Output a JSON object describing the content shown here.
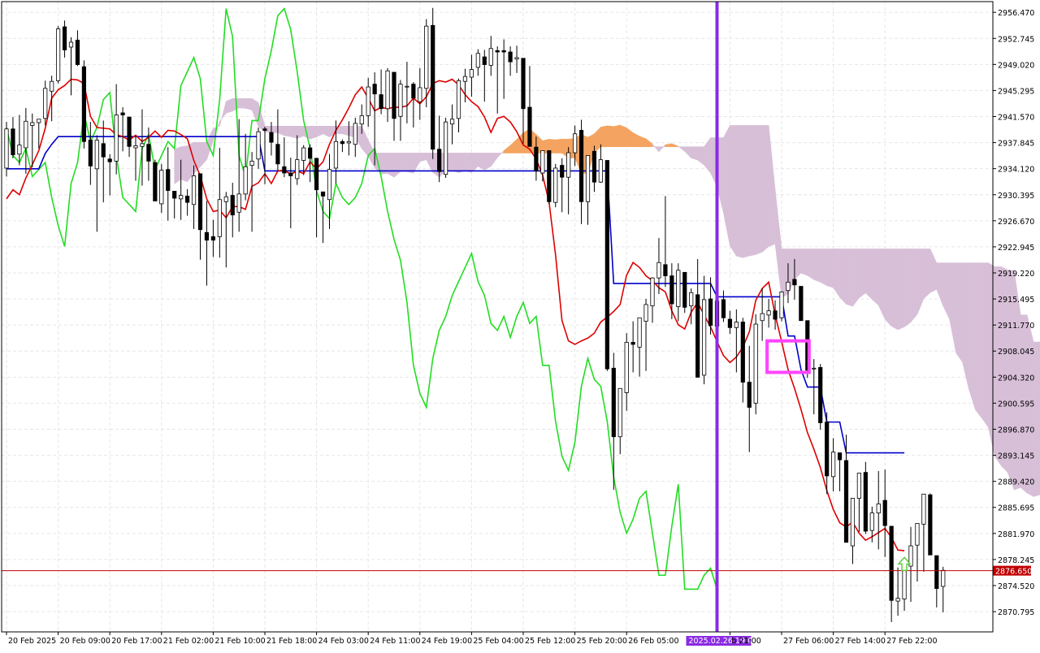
{
  "chart_data": {
    "type": "candlestick",
    "price_axis": {
      "ylim": [
        2867.9,
        2958.0
      ],
      "ticks": [
        "2956.470",
        "2952.745",
        "2949.020",
        "2945.295",
        "2941.570",
        "2937.845",
        "2934.120",
        "2930.395",
        "2926.670",
        "2922.945",
        "2919.220",
        "2915.495",
        "2911.770",
        "2908.045",
        "2904.320",
        "2900.595",
        "2896.870",
        "2893.145",
        "2889.420",
        "2885.695",
        "2881.970",
        "2878.245",
        "2874.520",
        "2870.795"
      ]
    },
    "time_axis": {
      "bar_count": 138,
      "labels": [
        {
          "bar": 0,
          "text": "20 Feb 2025"
        },
        {
          "bar": 8,
          "text": "20 Feb 09:00"
        },
        {
          "bar": 16,
          "text": "20 Feb 17:00"
        },
        {
          "bar": 24,
          "text": "21 Feb 02:00"
        },
        {
          "bar": 32,
          "text": "21 Feb 10:00"
        },
        {
          "bar": 40,
          "text": "21 Feb 18:00"
        },
        {
          "bar": 48,
          "text": "24 Feb 03:00"
        },
        {
          "bar": 56,
          "text": "24 Feb 11:00"
        },
        {
          "bar": 64,
          "text": "24 Feb 19:00"
        },
        {
          "bar": 72,
          "text": "25 Feb 04:00"
        },
        {
          "bar": 80,
          "text": "25 Feb 12:00"
        },
        {
          "bar": 88,
          "text": "25 Feb 20:00"
        },
        {
          "bar": 96,
          "text": "26 Feb 05:00"
        },
        {
          "bar": 112,
          "text": "b 21:00"
        },
        {
          "bar": 120,
          "text": "27 Feb 06:00"
        },
        {
          "bar": 128,
          "text": "27 Feb 14:00"
        },
        {
          "bar": 136,
          "text": "27 Feb 22:00"
        }
      ]
    },
    "current_price": {
      "value": 2876.65,
      "label": "2876.650",
      "color": "#c00000"
    },
    "vertical_marker": {
      "bar": 110,
      "label": "2025.02.26 19:00",
      "color": "#8a2be2"
    },
    "highlight_box": {
      "bar_from": 118,
      "bar_to": 124,
      "price_from": 2905.0,
      "price_to": 2909.5,
      "color": "#ff44ff"
    },
    "signal_arrow": {
      "bar": 139,
      "price": 2877.5,
      "direction": "up",
      "color": "#55cc33"
    },
    "colors": {
      "tenkan": "#dd0000",
      "kijun": "#0000cc",
      "chikou": "#22dd22",
      "cloud_bull": "#f4a460",
      "cloud_bear": "#d8bfd8",
      "candle_bull": "#ffffff",
      "candle_bear": "#000000",
      "candle_border": "#000000",
      "grid": "#e6e6e6"
    },
    "candles": [
      [
        2934.2,
        2940.8,
        2933.0,
        2939.8
      ],
      [
        2939.8,
        2941.5,
        2935.6,
        2936.1
      ],
      [
        2936.2,
        2941.8,
        2934.6,
        2937.5
      ],
      [
        2937.1,
        2942.8,
        2933.4,
        2940.9
      ],
      [
        2940.3,
        2942.0,
        2934.3,
        2940.7
      ],
      [
        2940.7,
        2941.1,
        2937.0,
        2941.2
      ],
      [
        2941.3,
        2946.7,
        2940.3,
        2945.6
      ],
      [
        2945.2,
        2947.4,
        2940.9,
        2946.6
      ],
      [
        2946.7,
        2954.5,
        2946.3,
        2954.1
      ],
      [
        2954.4,
        2955.3,
        2950.0,
        2951.1
      ],
      [
        2951.5,
        2952.9,
        2944.6,
        2952.2
      ],
      [
        2952.5,
        2953.9,
        2948.8,
        2949.0
      ],
      [
        2948.7,
        2949.6,
        2937.0,
        2938.0
      ],
      [
        2938.2,
        2940.8,
        2931.8,
        2934.5
      ],
      [
        2934.1,
        2938.9,
        2925.1,
        2938.2
      ],
      [
        2937.7,
        2941.0,
        2929.3,
        2935.8
      ],
      [
        2935.5,
        2936.2,
        2930.3,
        2935.1
      ],
      [
        2935.2,
        2946.2,
        2933.3,
        2941.8
      ],
      [
        2942.1,
        2942.9,
        2936.6,
        2941.8
      ],
      [
        2941.5,
        2940.7,
        2935.8,
        2937.3
      ],
      [
        2937.1,
        2938.9,
        2932.4,
        2937.4
      ],
      [
        2937.3,
        2942.6,
        2931.7,
        2937.7
      ],
      [
        2937.6,
        2940.0,
        2932.4,
        2935.2
      ],
      [
        2935.0,
        2935.4,
        2930.4,
        2929.5
      ],
      [
        2929.1,
        2934.8,
        2927.8,
        2933.9
      ],
      [
        2934.0,
        2937.2,
        2926.7,
        2931.0
      ],
      [
        2930.9,
        2930.8,
        2927.0,
        2929.9
      ],
      [
        2929.8,
        2935.4,
        2926.8,
        2930.3
      ],
      [
        2930.2,
        2931.2,
        2927.4,
        2929.3
      ],
      [
        2929.0,
        2934.6,
        2925.5,
        2933.1
      ],
      [
        2933.4,
        2933.4,
        2921.1,
        2925.4
      ],
      [
        2925.0,
        2929.5,
        2917.4,
        2923.9
      ],
      [
        2924.4,
        2926.8,
        2921.5,
        2923.9
      ],
      [
        2924.4,
        2937.1,
        2921.4,
        2929.7
      ],
      [
        2929.4,
        2930.8,
        2920.0,
        2930.1
      ],
      [
        2930.3,
        2932.1,
        2924.3,
        2927.5
      ],
      [
        2927.9,
        2941.2,
        2925.1,
        2930.5
      ],
      [
        2930.5,
        2939.1,
        2929.6,
        2934.4
      ],
      [
        2934.6,
        2936.5,
        2925.1,
        2935.2
      ],
      [
        2935.5,
        2940.0,
        2934.1,
        2939.4
      ],
      [
        2939.8,
        2940.1,
        2931.9,
        2939.6
      ],
      [
        2939.3,
        2940.8,
        2936.0,
        2937.9
      ],
      [
        2937.6,
        2942.6,
        2933.7,
        2934.8
      ],
      [
        2934.4,
        2938.6,
        2932.9,
        2933.5
      ],
      [
        2933.5,
        2935.7,
        2925.6,
        2933.1
      ],
      [
        2932.7,
        2938.9,
        2931.8,
        2935.4
      ],
      [
        2935.3,
        2937.5,
        2933.2,
        2937.1
      ],
      [
        2937.1,
        2937.6,
        2932.2,
        2935.6
      ],
      [
        2935.6,
        2934.2,
        2924.3,
        2931.1
      ],
      [
        2930.8,
        2930.6,
        2923.5,
        2930.2
      ],
      [
        2929.7,
        2936.2,
        2925.5,
        2934.0
      ],
      [
        2934.2,
        2941.0,
        2932.0,
        2938.0
      ],
      [
        2938.0,
        2938.3,
        2936.5,
        2937.7
      ],
      [
        2937.8,
        2940.9,
        2936.0,
        2938.0
      ],
      [
        2937.6,
        2941.4,
        2935.8,
        2940.6
      ],
      [
        2940.5,
        2943.3,
        2939.1,
        2941.7
      ],
      [
        2941.7,
        2947.1,
        2940.1,
        2945.8
      ],
      [
        2946.2,
        2947.9,
        2934.6,
        2944.8
      ],
      [
        2944.7,
        2948.3,
        2941.9,
        2942.7
      ],
      [
        2942.7,
        2948.5,
        2940.8,
        2948.1
      ],
      [
        2947.9,
        2947.4,
        2938.1,
        2941.3
      ],
      [
        2941.6,
        2946.8,
        2938.1,
        2946.2
      ],
      [
        2945.9,
        2949.4,
        2940.6,
        2945.9
      ],
      [
        2946.2,
        2946.5,
        2940.0,
        2944.2
      ],
      [
        2943.7,
        2948.5,
        2941.1,
        2945.7
      ],
      [
        2945.6,
        2955.5,
        2942.9,
        2954.5
      ],
      [
        2954.6,
        2957.1,
        2935.5,
        2936.9
      ],
      [
        2936.9,
        2941.7,
        2932.2,
        2933.7
      ],
      [
        2933.3,
        2941.4,
        2932.8,
        2940.8
      ],
      [
        2940.5,
        2943.3,
        2937.6,
        2941.2
      ],
      [
        2941.3,
        2947.0,
        2939.3,
        2946.7
      ],
      [
        2946.6,
        2948.4,
        2943.6,
        2947.3
      ],
      [
        2947.2,
        2950.4,
        2944.4,
        2948.3
      ],
      [
        2948.6,
        2951.2,
        2947.4,
        2950.6
      ],
      [
        2950.1,
        2951.1,
        2943.7,
        2949.0
      ],
      [
        2948.9,
        2953.1,
        2947.4,
        2951.3
      ],
      [
        2951.0,
        2951.6,
        2942.0,
        2950.8
      ],
      [
        2951.0,
        2952.6,
        2944.1,
        2950.8
      ],
      [
        2950.8,
        2951.6,
        2947.4,
        2949.4
      ],
      [
        2949.8,
        2951.7,
        2947.8,
        2950.0
      ],
      [
        2949.9,
        2945.7,
        2937.7,
        2942.7
      ],
      [
        2942.9,
        2948.8,
        2937.7,
        2937.3
      ],
      [
        2937.2,
        2938.7,
        2932.4,
        2933.8
      ],
      [
        2933.5,
        2936.6,
        2932.3,
        2936.7
      ],
      [
        2936.7,
        2934.7,
        2929.1,
        2929.4
      ],
      [
        2929.3,
        2934.8,
        2928.6,
        2934.2
      ],
      [
        2934.6,
        2935.6,
        2927.9,
        2932.9
      ],
      [
        2932.9,
        2937.2,
        2927.6,
        2936.4
      ],
      [
        2936.4,
        2940.3,
        2934.5,
        2939.1
      ],
      [
        2939.6,
        2941.1,
        2926.2,
        2929.4
      ],
      [
        2929.4,
        2932.6,
        2926.1,
        2936.0
      ],
      [
        2936.6,
        2937.4,
        2930.8,
        2932.2
      ],
      [
        2932.2,
        2937.6,
        2932.1,
        2935.4
      ],
      [
        2935.3,
        2934.6,
        2905.2,
        2905.5
      ],
      [
        2905.6,
        2907.8,
        2888.2,
        2895.8
      ],
      [
        2895.8,
        2902.3,
        2893.3,
        2902.7
      ],
      [
        2902.1,
        2910.6,
        2899.5,
        2909.3
      ],
      [
        2909.3,
        2912.3,
        2905.0,
        2909.0
      ],
      [
        2908.6,
        2912.5,
        2904.4,
        2912.8
      ],
      [
        2912.3,
        2915.5,
        2905.2,
        2914.7
      ],
      [
        2914.5,
        2918.6,
        2912.1,
        2918.5
      ],
      [
        2918.5,
        2924.2,
        2916.2,
        2920.7
      ],
      [
        2920.4,
        2930.2,
        2917.2,
        2918.8
      ],
      [
        2918.8,
        2920.6,
        2912.6,
        2914.8
      ],
      [
        2914.4,
        2920.6,
        2912.3,
        2919.6
      ],
      [
        2919.3,
        2919.2,
        2913.5,
        2914.3
      ],
      [
        2914.5,
        2917.0,
        2911.9,
        2916.4
      ],
      [
        2916.1,
        2921.2,
        2904.9,
        2904.3
      ],
      [
        2904.6,
        2918.8,
        2903.3,
        2915.4
      ],
      [
        2915.5,
        2918.6,
        2910.4,
        2911.7
      ],
      [
        2911.6,
        2915.4,
        2906.4,
        2915.2
      ],
      [
        2915.4,
        2916.7,
        2912.2,
        2912.8
      ],
      [
        2912.6,
        2913.8,
        2910.5,
        2911.4
      ],
      [
        2911.4,
        2914.0,
        2905.0,
        2912.2
      ],
      [
        2912.2,
        2912.8,
        2900.7,
        2903.6
      ],
      [
        2903.6,
        2908.8,
        2893.6,
        2900.0
      ],
      [
        2900.6,
        2913.3,
        2899.0,
        2911.9
      ],
      [
        2912.4,
        2917.0,
        2909.5,
        2913.4
      ],
      [
        2913.2,
        2915.5,
        2911.4,
        2913.8
      ],
      [
        2913.8,
        2915.3,
        2911.1,
        2912.6
      ],
      [
        2912.8,
        2916.6,
        2912.3,
        2916.5
      ],
      [
        2916.7,
        2920.6,
        2914.9,
        2917.9
      ],
      [
        2918.3,
        2921.2,
        2915.4,
        2917.5
      ],
      [
        2917.3,
        2916.2,
        2913.4,
        2912.4
      ],
      [
        2912.4,
        2908.0,
        2904.2,
        2905.3
      ],
      [
        2905.6,
        2906.9,
        2899.0,
        2905.6
      ],
      [
        2905.7,
        2906.2,
        2896.8,
        2897.8
      ],
      [
        2897.9,
        2899.3,
        2887.6,
        2890.2
      ],
      [
        2890.1,
        2895.6,
        2888.0,
        2893.6
      ],
      [
        2893.5,
        2893.5,
        2888.0,
        2892.5
      ],
      [
        2892.4,
        2896.1,
        2887.4,
        2880.7
      ],
      [
        2880.2,
        2886.4,
        2877.6,
        2887.0
      ],
      [
        2887.0,
        2889.9,
        2882.2,
        2890.6
      ],
      [
        2890.7,
        2892.2,
        2881.9,
        2882.3
      ],
      [
        2882.4,
        2885.8,
        2880.7,
        2884.9
      ],
      [
        2884.9,
        2890.9,
        2879.7,
        2886.2
      ],
      [
        2886.7,
        2891.1,
        2878.6,
        2883.1
      ],
      [
        2883.0,
        2879.5,
        2869.3,
        2872.4
      ],
      [
        2872.3,
        2877.1,
        2870.2,
        2872.7
      ],
      [
        2872.6,
        2876.8,
        2870.9,
        2877.3
      ],
      [
        2877.3,
        2882.9,
        2872.2,
        2880.2
      ],
      [
        2880.3,
        2883.4,
        2875.1,
        2883.4
      ],
      [
        2883.3,
        2887.4,
        2876.5,
        2887.6
      ],
      [
        2887.5,
        2887.7,
        2880.9,
        2878.9
      ],
      [
        2878.8,
        2878.3,
        2871.4,
        2874.1
      ],
      [
        2874.4,
        2877.2,
        2870.7,
        2876.7
      ]
    ],
    "tenkan": [
      2929.8,
      2931.1,
      2930.4,
      2932.8,
      2934.7,
      2936.7,
      2939.9,
      2944.2,
      2945.4,
      2946.0,
      2946.9,
      2946.8,
      2946.3,
      2941.6,
      2940.0,
      2939.9,
      2939.8,
      2939.0,
      2938.7,
      2938.2,
      2938.9,
      2938.0,
      2938.6,
      2939.5,
      2938.6,
      2939.6,
      2939.5,
      2939.0,
      2938.4,
      2935.3,
      2933.1,
      2929.8,
      2928.0,
      2928.2,
      2927.1,
      2928.7,
      2928.7,
      2928.3,
      2931.6,
      2932.1,
      2933.4,
      2932.0,
      2933.8,
      2933.9,
      2933.3,
      2933.8,
      2933.4,
      2935.1,
      2934.1,
      2935.1,
      2937.6,
      2939.6,
      2941.1,
      2942.8,
      2944.7,
      2945.8,
      2944.2,
      2942.4,
      2942.9,
      2942.7,
      2942.9,
      2942.9,
      2943.1,
      2944.2,
      2943.4,
      2944.4,
      2946.3,
      2946.7,
      2946.5,
      2946.9,
      2946.1,
      2944.7,
      2943.7,
      2943.0,
      2941.5,
      2939.3,
      2941.3,
      2941.6,
      2940.8,
      2939.4,
      2937.5,
      2936.9,
      2935.5,
      2933.2,
      2929.3,
      2921.8,
      2912.4,
      2909.5,
      2909.0,
      2909.5,
      2909.9,
      2910.6,
      2912.2,
      2912.9,
      2913.7,
      2914.7,
      2918.9,
      2920.7,
      2920.0,
      2918.8,
      2918.1,
      2917.1,
      2916.5,
      2913.8,
      2911.8,
      2911.2,
      2913.6,
      2915.0,
      2913.2,
      2911.5,
      2909.4,
      2907.4,
      2906.4,
      2907.2,
      2908.6,
      2910.8,
      2915.3,
      2917.0,
      2917.9,
      2913.2,
      2909.4,
      2905.4,
      2902.7,
      2899.7,
      2896.4,
      2894.0,
      2891.4,
      2888.1,
      2885.4,
      2883.5,
      2882.9,
      2883.6,
      2882.0,
      2881.0,
      2881.5,
      2882.1,
      2882.7,
      2881.4,
      2879.6,
      2879.5
    ],
    "kijun": [
      2934.1,
      2934.1,
      2934.1,
      2934.1,
      2934.1,
      2934.1,
      2936.3,
      2937.6,
      2938.7,
      2938.7,
      2938.7,
      2938.7,
      2938.7,
      2938.7,
      2938.7,
      2938.7,
      2938.7,
      2938.7,
      2938.7,
      2938.7,
      2938.7,
      2938.7,
      2938.7,
      2938.7,
      2938.7,
      2938.7,
      2938.7,
      2938.7,
      2938.7,
      2938.7,
      2938.7,
      2938.7,
      2938.7,
      2938.7,
      2938.7,
      2938.7,
      2938.7,
      2938.7,
      2938.7,
      2938.7,
      2933.8,
      2933.8,
      2933.8,
      2933.8,
      2933.8,
      2933.8,
      2933.8,
      2933.8,
      2933.8,
      2933.8,
      2933.8,
      2933.8,
      2933.8,
      2933.8,
      2933.8,
      2933.8,
      2933.8,
      2933.8,
      2933.8,
      2933.8,
      2933.8,
      2933.8,
      2933.8,
      2933.8,
      2933.8,
      2933.8,
      2933.8,
      2933.8,
      2933.8,
      2933.8,
      2933.8,
      2933.8,
      2933.8,
      2933.8,
      2933.8,
      2933.8,
      2933.8,
      2933.8,
      2933.8,
      2933.8,
      2933.8,
      2933.8,
      2933.8,
      2933.8,
      2933.8,
      2933.8,
      2933.8,
      2933.8,
      2933.8,
      2933.8,
      2933.8,
      2933.8,
      2933.8,
      2933.8,
      2917.7,
      2917.7,
      2917.7,
      2917.7,
      2917.7,
      2917.7,
      2917.7,
      2917.7,
      2917.7,
      2917.7,
      2917.7,
      2917.7,
      2917.7,
      2917.7,
      2917.7,
      2917.7,
      2915.8,
      2915.8,
      2915.8,
      2915.8,
      2915.8,
      2915.8,
      2915.8,
      2915.8,
      2915.8,
      2915.8,
      2915.8,
      2910.2,
      2910.2,
      2905.4,
      2902.9,
      2902.9,
      2902.9,
      2897.9,
      2897.9,
      2897.9,
      2893.5,
      2893.5,
      2893.5,
      2893.5,
      2893.5,
      2893.5,
      2893.5,
      2893.5,
      2893.5,
      2893.5
    ],
    "chikou": [
      2940,
      2936,
      2935,
      2937,
      2933,
      2934,
      2935,
      2930,
      2926,
      2923,
      2932,
      2935,
      2942,
      2938,
      2940,
      2944,
      2945,
      2936,
      2930,
      2929,
      2928,
      2937,
      2939,
      2934,
      2936,
      2938,
      2937,
      2946,
      2948,
      2950,
      2947,
      2938,
      2936,
      2944,
      2957,
      2953,
      2936,
      2933,
      2941,
      2941,
      2947,
      2951,
      2956,
      2957,
      2954,
      2948,
      2941,
      2937,
      2931,
      2928,
      2927,
      2932,
      2930,
      2929,
      2930,
      2932,
      2936,
      2937,
      2933,
      2928,
      2924,
      2921,
      2915,
      2906,
      2902,
      2900,
      2907,
      2911,
      2913,
      2916,
      2918,
      2920,
      2922,
      2918,
      2916,
      2912,
      2911,
      2913,
      2910,
      2913,
      2915,
      2912,
      2913,
      2906,
      2906,
      2898,
      2893,
      2891,
      2895,
      2903,
      2907,
      2904,
      2903,
      2898,
      2890,
      2885,
      2882,
      2884,
      2887,
      2888,
      2882,
      2876,
      2876,
      2883,
      2889,
      2874,
      2874,
      2874,
      2876,
      2877,
      2874
    ]
  }
}
